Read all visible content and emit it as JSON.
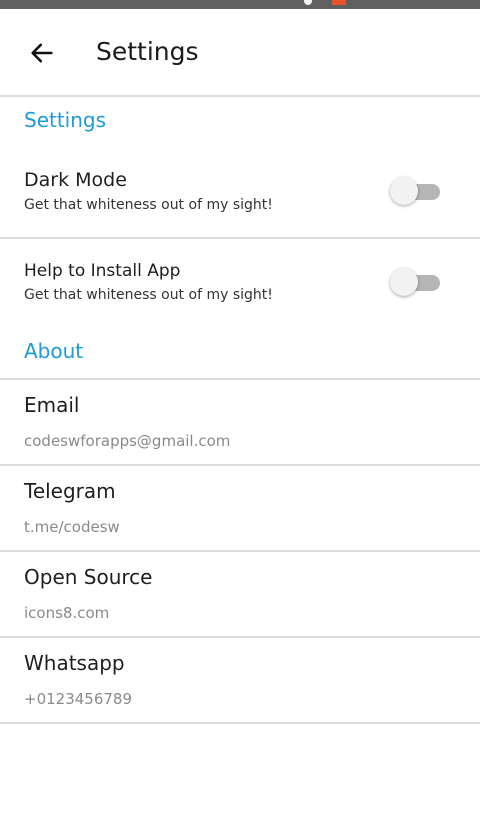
{
  "status_bar": {
    "background": "#5f5f5f",
    "accent": "#e8522c"
  },
  "app_bar": {
    "back_icon": "arrow-left-icon",
    "title": "Settings"
  },
  "sections": {
    "settings_label": "Settings",
    "about_label": "About"
  },
  "settings": [
    {
      "title": "Dark Mode",
      "subtitle": "Get that whiteness out of my sight!",
      "enabled": false
    },
    {
      "title": "Help to Install App",
      "subtitle": "Get that whiteness out of my sight!",
      "enabled": false
    }
  ],
  "about": [
    {
      "title": "Email",
      "value": "codeswforapps@gmail.com"
    },
    {
      "title": "Telegram",
      "value": "t.me/codesw"
    },
    {
      "title": "Open Source",
      "value": "icons8.com"
    },
    {
      "title": "Whatsapp",
      "value": "+0123456789"
    }
  ],
  "colors": {
    "accent": "#1e9ad6",
    "divider": "#dcdcdc",
    "secondary_text": "#8a8a8a"
  }
}
